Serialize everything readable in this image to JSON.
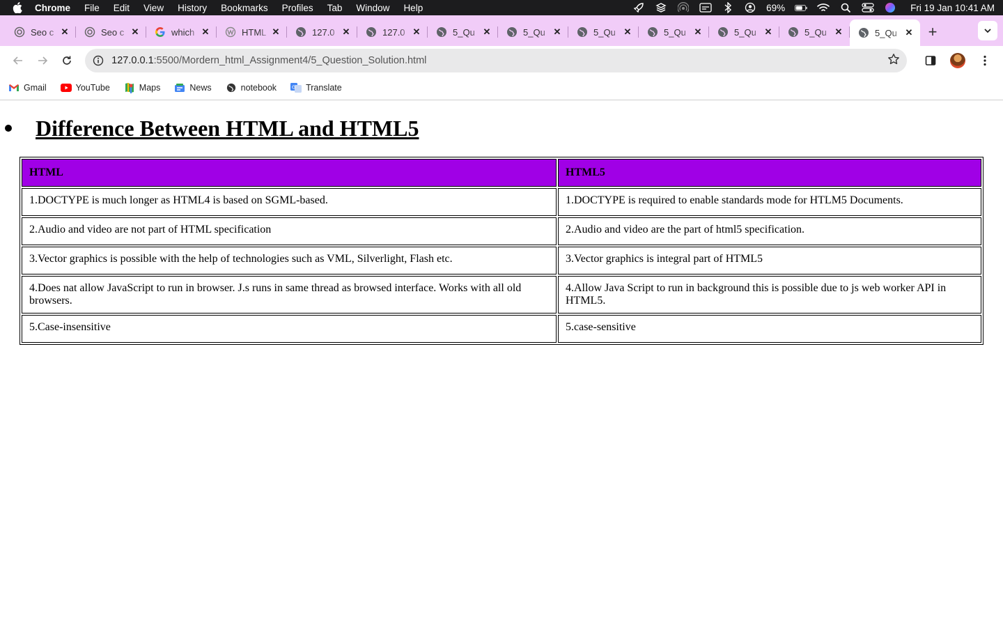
{
  "menubar": {
    "app": "Chrome",
    "items": [
      "File",
      "Edit",
      "View",
      "History",
      "Bookmarks",
      "Profiles",
      "Tab",
      "Window",
      "Help"
    ],
    "battery": "69%",
    "clock": "Fri 19 Jan  10:41 AM"
  },
  "tabs": [
    {
      "title": "Seo c",
      "icon": "seo-icon"
    },
    {
      "title": "Seo c",
      "icon": "seo-icon"
    },
    {
      "title": "which",
      "icon": "google-icon"
    },
    {
      "title": "HTML",
      "icon": "w3-icon"
    },
    {
      "title": "127.0",
      "icon": "globe-icon"
    },
    {
      "title": "127.0",
      "icon": "globe-icon"
    },
    {
      "title": "5_Qu",
      "icon": "globe-icon"
    },
    {
      "title": "5_Qu",
      "icon": "globe-icon"
    },
    {
      "title": "5_Qu",
      "icon": "globe-icon"
    },
    {
      "title": "5_Qu",
      "icon": "globe-icon"
    },
    {
      "title": "5_Qu",
      "icon": "globe-icon"
    },
    {
      "title": "5_Qu",
      "icon": "globe-icon"
    },
    {
      "title": "5_Qu",
      "icon": "globe-icon",
      "active": true
    }
  ],
  "toolbar": {
    "url_host": "127.0.0.1",
    "url_path": ":5500/Mordern_html_Assignment4/5_Question_Solution.html"
  },
  "bookmarks": [
    {
      "label": "Gmail",
      "icon": "gmail-icon"
    },
    {
      "label": "YouTube",
      "icon": "youtube-icon"
    },
    {
      "label": "Maps",
      "icon": "maps-icon"
    },
    {
      "label": "News",
      "icon": "news-icon"
    },
    {
      "label": "notebook",
      "icon": "globe-icon"
    },
    {
      "label": "Translate",
      "icon": "translate-icon"
    }
  ],
  "content": {
    "heading": "Difference Between HTML and HTML5",
    "table": {
      "headers": [
        "HTML",
        "HTML5"
      ],
      "rows": [
        [
          "1.DOCTYPE is much longer as HTML4 is based on SGML-based.",
          "1.DOCTYPE is required to enable standards mode for HTLM5 Documents."
        ],
        [
          "2.Audio and video are not part of HTML specification",
          "2.Audio and video are the part of html5 specification."
        ],
        [
          "3.Vector graphics is possible with the help of technologies such as VML, Silverlight, Flash etc.",
          "3.Vector graphics is integral part of HTML5"
        ],
        [
          "4.Does nat allow JavaScript to run in browser. J.s runs in same thread as browsed interface. Works with all old browsers.",
          "4.Allow Java Script to run in background this is possible due to js web worker API in HTML5."
        ],
        [
          "5.Case-insensitive",
          "5.case-sensitive"
        ]
      ]
    }
  },
  "colors": {
    "header_bg": "#a000e6",
    "tabstrip_bg": "#f1ccf8"
  }
}
